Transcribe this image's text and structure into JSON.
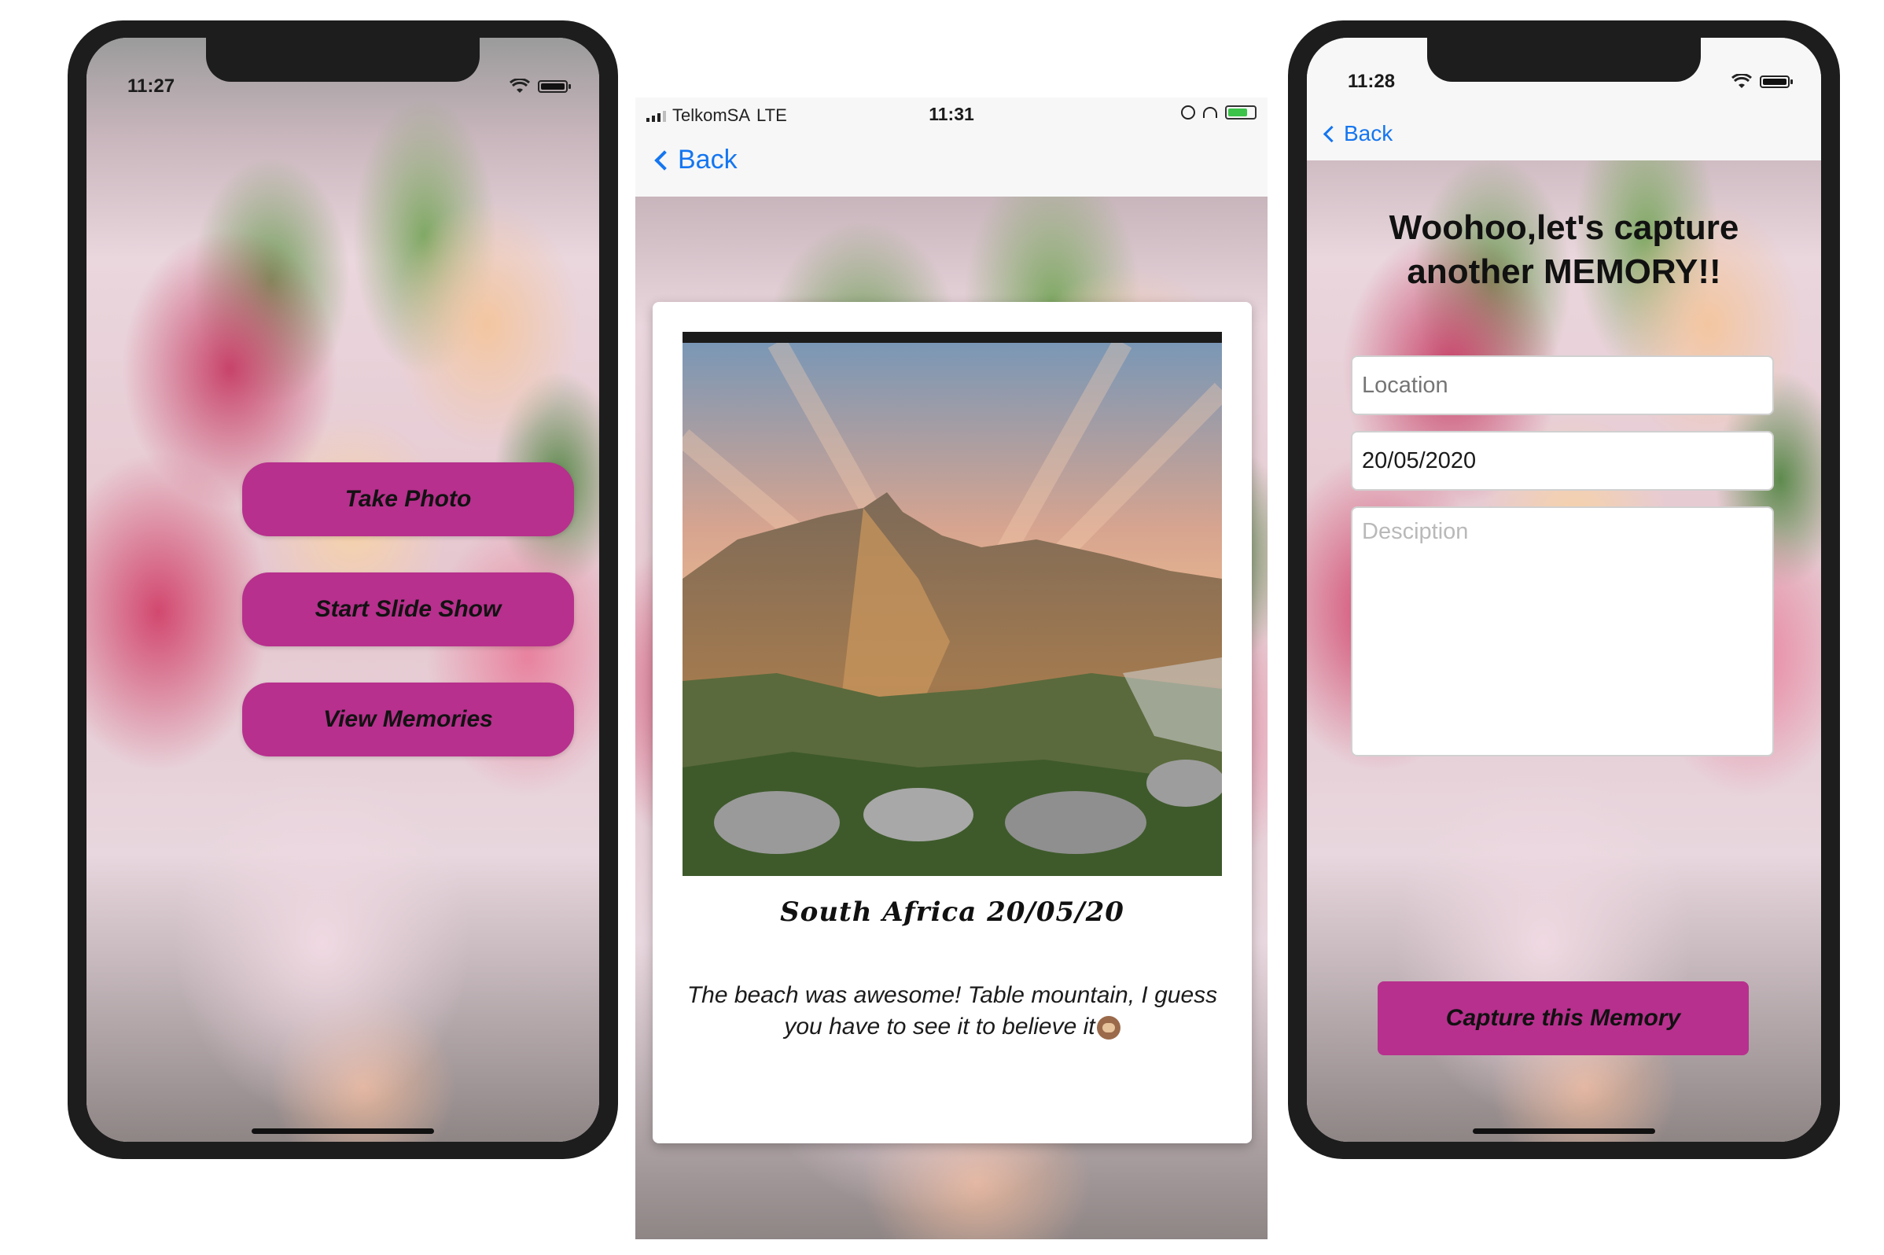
{
  "phone_home": {
    "status_time": "11:27",
    "buttons": {
      "take_photo": "Take Photo",
      "start_slide_show": "Start Slide Show",
      "view_memories": "View Memories"
    }
  },
  "memory_detail": {
    "status": {
      "carrier": "TelkomSA",
      "network": "LTE",
      "time": "11:31"
    },
    "back_label": "Back",
    "title": "South Africa  20/05/20",
    "description": "The beach was awesome! Table mountain, I guess you have to see it to believe it",
    "emoji_icon": "see-no-evil-monkey-icon"
  },
  "capture_form": {
    "status_time": "11:28",
    "back_label": "Back",
    "headline": "Woohoo,let's capture another MEMORY!!",
    "location": {
      "value": "",
      "placeholder": "Location"
    },
    "date": {
      "value": "20/05/2020"
    },
    "description": {
      "value": "",
      "placeholder": "Desciption"
    },
    "capture_button": "Capture this Memory"
  },
  "colors": {
    "button_magenta": "#b7308d",
    "ios_link_blue": "#1576f0",
    "frame_black": "#1d1d1d"
  }
}
